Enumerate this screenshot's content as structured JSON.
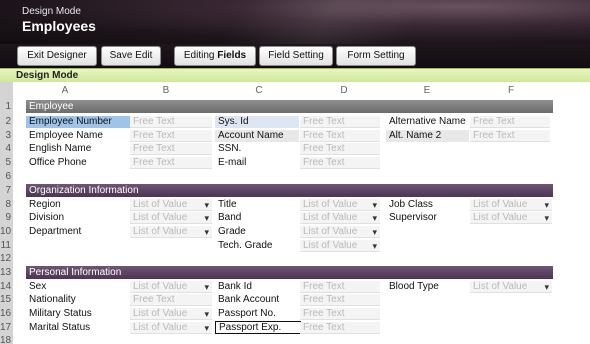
{
  "header": {
    "mode_label": "Design Mode",
    "title": "Employees"
  },
  "toolbar": {
    "exit_designer": "Exit Designer",
    "save_edit": "Save Edit",
    "editing_fields_prefix": "Editing ",
    "editing_fields_bold": "Fields",
    "field_setting": "Field Setting",
    "form_setting": "Form Setting"
  },
  "modebar": {
    "label": "Design Mode"
  },
  "columns": [
    "A",
    "B",
    "C",
    "D",
    "E",
    "F"
  ],
  "rows": [
    "1",
    "2",
    "3",
    "4",
    "5",
    "6",
    "7",
    "8",
    "9",
    "10",
    "11",
    "12",
    "13",
    "14",
    "15",
    "16",
    "17",
    "18"
  ],
  "sections": {
    "employee": "Employee",
    "organization": "Organization Information",
    "personal": "Personal Information"
  },
  "placeholders": {
    "free_text": "Free Text",
    "list_of_value": "List of Value"
  },
  "fields": {
    "r2": [
      "Employee Number",
      "Sys. Id",
      "Alternative Name"
    ],
    "r3": [
      "Employee Name",
      "Account Name",
      "Alt. Name 2"
    ],
    "r4": [
      "English Name",
      "SSN."
    ],
    "r5": [
      "Office Phone",
      "E-mail"
    ],
    "r8": [
      "Region",
      "Title",
      "Job Class"
    ],
    "r9": [
      "Division",
      "Band",
      "Supervisor"
    ],
    "r10": [
      "Department",
      "Grade"
    ],
    "r11": [
      "Tech. Grade"
    ],
    "r14": [
      "Sex",
      "Bank Id",
      "Blood Type"
    ],
    "r15": [
      "Nationality",
      "Bank Account"
    ],
    "r16": [
      "Military Status",
      "Passport No."
    ],
    "r17": [
      "Marital Status",
      "Passport Exp."
    ]
  }
}
